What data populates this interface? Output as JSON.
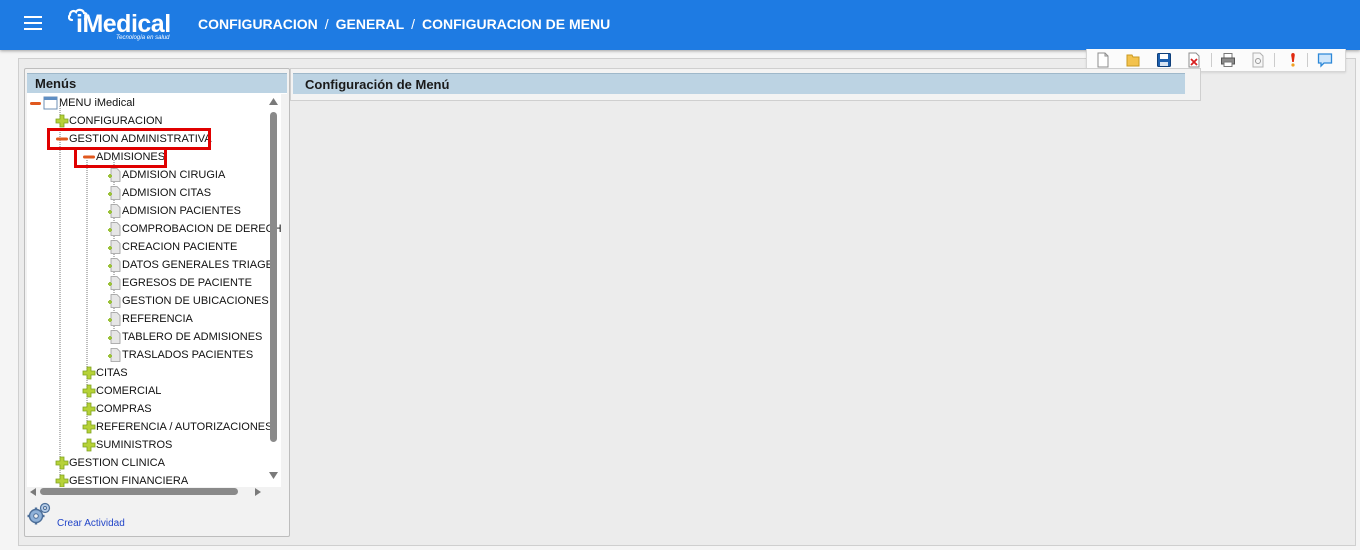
{
  "header": {
    "logo_text": "iMedical",
    "logo_tagline": "Tecnología en salud",
    "breadcrumb": [
      "CONFIGURACION",
      "GENERAL",
      "CONFIGURACION DE MENU"
    ],
    "breadcrumb_sep": "/"
  },
  "toolbar": {
    "icons": [
      "new-document-icon",
      "open-folder-icon",
      "save-icon",
      "delete-icon",
      "print-icon",
      "print-preview-icon",
      "alert-icon",
      "comment-icon"
    ]
  },
  "left_panel": {
    "title": "Menús",
    "create_label": "Crear Actividad"
  },
  "right_panel": {
    "title": "Configuración de Menú"
  },
  "tree": {
    "root": "MENU iMedical",
    "configuracion": "CONFIGURACION",
    "gestion_administrativa": "GESTION ADMINISTRATIVA",
    "admisiones": "ADMISIONES",
    "admisiones_children": [
      "ADMISION CIRUGIA",
      "ADMISION CITAS",
      "ADMISION PACIENTES",
      "COMPROBACION DE DERECHOS",
      "CREACION PACIENTE",
      "DATOS GENERALES TRIAGE",
      "EGRESOS DE PACIENTE",
      "GESTION DE UBICACIONES",
      "REFERENCIA",
      "TABLERO DE ADMISIONES",
      "TRASLADOS PACIENTES"
    ],
    "admin_siblings": [
      "CITAS",
      "COMERCIAL",
      "COMPRAS",
      "REFERENCIA / AUTORIZACIONES",
      "SUMINISTROS"
    ],
    "gestion_clinica": "GESTION CLINICA",
    "gestion_financiera": "GESTION FINANCIERA"
  },
  "colors": {
    "header_bg": "#1e7be3",
    "panel_header_bg": "#bcd3e3",
    "highlight": "#e00000",
    "link": "#2245c8"
  }
}
